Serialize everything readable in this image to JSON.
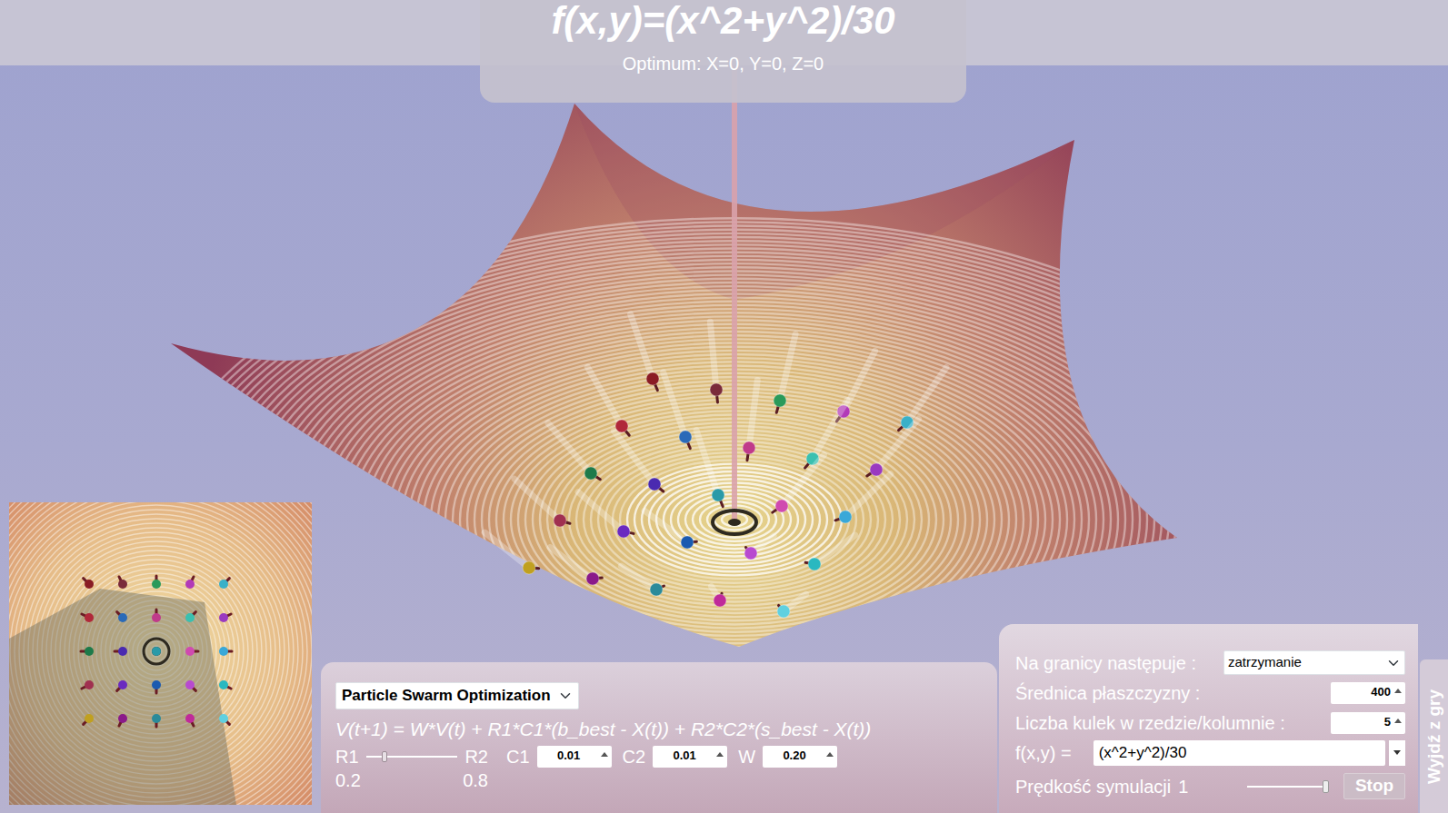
{
  "header": {
    "title": "f(x,y)=(x^2+y^2)/30",
    "optimum": "Optimum: X=0, Y=0, Z=0"
  },
  "algorithm": {
    "label": "Particle Swarm Optimization"
  },
  "formula": "V(t+1) = W*V(t) + R1*C1*(b_best - X(t)) + R2*C2*(s_best - X(t))",
  "r_slider": {
    "left_label": "R1",
    "right_label": "R2",
    "left_value": "0.2",
    "right_value": "0.8",
    "level": 0.2
  },
  "coefficients": [
    {
      "label": "C1",
      "value": "0.01"
    },
    {
      "label": "C2",
      "value": "0.01"
    },
    {
      "label": "W",
      "value": "0.20"
    }
  ],
  "settings": {
    "boundary": {
      "label": "Na granicy następuje :",
      "value": "zatrzymanie"
    },
    "diameter": {
      "label": "Średnica płaszczyzny :",
      "value": "400"
    },
    "count": {
      "label": "Liczba kulek w rzedzie/kolumnie :",
      "value": "5"
    },
    "function": {
      "label": "f(x,y) =",
      "value": "(x^2+y^2)/30"
    },
    "speed": {
      "label": "Prędkość symulacji",
      "value": "1",
      "level": 0.97
    }
  },
  "stop_button": "Stop",
  "exit_tab": "Wyjdź z gry",
  "particles": [
    {
      "color": "#8a1c24"
    },
    {
      "color": "#7a2a3a"
    },
    {
      "color": "#2a9a5a"
    },
    {
      "color": "#b23ab8"
    },
    {
      "color": "#3ab0c8"
    },
    {
      "color": "#b0283a"
    },
    {
      "color": "#2a6ab8"
    },
    {
      "color": "#c03a8a"
    },
    {
      "color": "#3ac0b0"
    },
    {
      "color": "#9a3ac0"
    },
    {
      "color": "#1e7a4a"
    },
    {
      "color": "#4a2ab0"
    },
    {
      "color": "#2a9aa8"
    },
    {
      "color": "#d04ab0"
    },
    {
      "color": "#3aa8d8"
    },
    {
      "color": "#a03050"
    },
    {
      "color": "#6a2ac0"
    },
    {
      "color": "#1a5ab0"
    },
    {
      "color": "#b84ad0"
    },
    {
      "color": "#2ab8c0"
    },
    {
      "color": "#c0a020"
    },
    {
      "color": "#8a1a8a"
    },
    {
      "color": "#2a8a9a"
    },
    {
      "color": "#c02a9a"
    },
    {
      "color": "#60d0e0"
    }
  ]
}
